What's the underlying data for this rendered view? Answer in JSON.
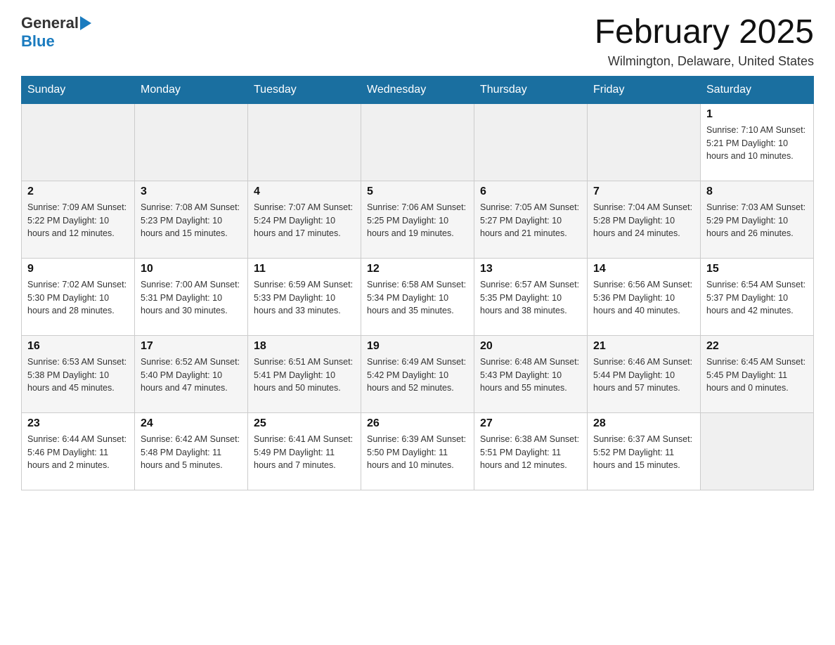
{
  "header": {
    "logo_general": "General",
    "logo_blue": "Blue",
    "month_title": "February 2025",
    "location": "Wilmington, Delaware, United States"
  },
  "weekdays": [
    "Sunday",
    "Monday",
    "Tuesday",
    "Wednesday",
    "Thursday",
    "Friday",
    "Saturday"
  ],
  "weeks": [
    [
      {
        "day": "",
        "info": ""
      },
      {
        "day": "",
        "info": ""
      },
      {
        "day": "",
        "info": ""
      },
      {
        "day": "",
        "info": ""
      },
      {
        "day": "",
        "info": ""
      },
      {
        "day": "",
        "info": ""
      },
      {
        "day": "1",
        "info": "Sunrise: 7:10 AM\nSunset: 5:21 PM\nDaylight: 10 hours and 10 minutes."
      }
    ],
    [
      {
        "day": "2",
        "info": "Sunrise: 7:09 AM\nSunset: 5:22 PM\nDaylight: 10 hours and 12 minutes."
      },
      {
        "day": "3",
        "info": "Sunrise: 7:08 AM\nSunset: 5:23 PM\nDaylight: 10 hours and 15 minutes."
      },
      {
        "day": "4",
        "info": "Sunrise: 7:07 AM\nSunset: 5:24 PM\nDaylight: 10 hours and 17 minutes."
      },
      {
        "day": "5",
        "info": "Sunrise: 7:06 AM\nSunset: 5:25 PM\nDaylight: 10 hours and 19 minutes."
      },
      {
        "day": "6",
        "info": "Sunrise: 7:05 AM\nSunset: 5:27 PM\nDaylight: 10 hours and 21 minutes."
      },
      {
        "day": "7",
        "info": "Sunrise: 7:04 AM\nSunset: 5:28 PM\nDaylight: 10 hours and 24 minutes."
      },
      {
        "day": "8",
        "info": "Sunrise: 7:03 AM\nSunset: 5:29 PM\nDaylight: 10 hours and 26 minutes."
      }
    ],
    [
      {
        "day": "9",
        "info": "Sunrise: 7:02 AM\nSunset: 5:30 PM\nDaylight: 10 hours and 28 minutes."
      },
      {
        "day": "10",
        "info": "Sunrise: 7:00 AM\nSunset: 5:31 PM\nDaylight: 10 hours and 30 minutes."
      },
      {
        "day": "11",
        "info": "Sunrise: 6:59 AM\nSunset: 5:33 PM\nDaylight: 10 hours and 33 minutes."
      },
      {
        "day": "12",
        "info": "Sunrise: 6:58 AM\nSunset: 5:34 PM\nDaylight: 10 hours and 35 minutes."
      },
      {
        "day": "13",
        "info": "Sunrise: 6:57 AM\nSunset: 5:35 PM\nDaylight: 10 hours and 38 minutes."
      },
      {
        "day": "14",
        "info": "Sunrise: 6:56 AM\nSunset: 5:36 PM\nDaylight: 10 hours and 40 minutes."
      },
      {
        "day": "15",
        "info": "Sunrise: 6:54 AM\nSunset: 5:37 PM\nDaylight: 10 hours and 42 minutes."
      }
    ],
    [
      {
        "day": "16",
        "info": "Sunrise: 6:53 AM\nSunset: 5:38 PM\nDaylight: 10 hours and 45 minutes."
      },
      {
        "day": "17",
        "info": "Sunrise: 6:52 AM\nSunset: 5:40 PM\nDaylight: 10 hours and 47 minutes."
      },
      {
        "day": "18",
        "info": "Sunrise: 6:51 AM\nSunset: 5:41 PM\nDaylight: 10 hours and 50 minutes."
      },
      {
        "day": "19",
        "info": "Sunrise: 6:49 AM\nSunset: 5:42 PM\nDaylight: 10 hours and 52 minutes."
      },
      {
        "day": "20",
        "info": "Sunrise: 6:48 AM\nSunset: 5:43 PM\nDaylight: 10 hours and 55 minutes."
      },
      {
        "day": "21",
        "info": "Sunrise: 6:46 AM\nSunset: 5:44 PM\nDaylight: 10 hours and 57 minutes."
      },
      {
        "day": "22",
        "info": "Sunrise: 6:45 AM\nSunset: 5:45 PM\nDaylight: 11 hours and 0 minutes."
      }
    ],
    [
      {
        "day": "23",
        "info": "Sunrise: 6:44 AM\nSunset: 5:46 PM\nDaylight: 11 hours and 2 minutes."
      },
      {
        "day": "24",
        "info": "Sunrise: 6:42 AM\nSunset: 5:48 PM\nDaylight: 11 hours and 5 minutes."
      },
      {
        "day": "25",
        "info": "Sunrise: 6:41 AM\nSunset: 5:49 PM\nDaylight: 11 hours and 7 minutes."
      },
      {
        "day": "26",
        "info": "Sunrise: 6:39 AM\nSunset: 5:50 PM\nDaylight: 11 hours and 10 minutes."
      },
      {
        "day": "27",
        "info": "Sunrise: 6:38 AM\nSunset: 5:51 PM\nDaylight: 11 hours and 12 minutes."
      },
      {
        "day": "28",
        "info": "Sunrise: 6:37 AM\nSunset: 5:52 PM\nDaylight: 11 hours and 15 minutes."
      },
      {
        "day": "",
        "info": ""
      }
    ]
  ]
}
